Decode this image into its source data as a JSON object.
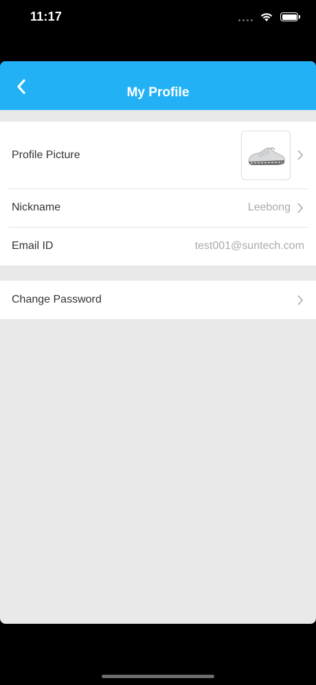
{
  "status_bar": {
    "time": "11:17"
  },
  "nav": {
    "title": "My Profile"
  },
  "profile": {
    "picture_label": "Profile Picture",
    "nickname_label": "Nickname",
    "nickname_value": "Leebong",
    "email_label": "Email ID",
    "email_value": "test001@suntech.com"
  },
  "security": {
    "change_password_label": "Change Password"
  },
  "colors": {
    "accent": "#23b1f5",
    "background": "#e9e9e9"
  },
  "icons": [
    "back-chevron-icon",
    "chevron-right-icon",
    "wifi-icon",
    "battery-icon",
    "signal-icon"
  ]
}
